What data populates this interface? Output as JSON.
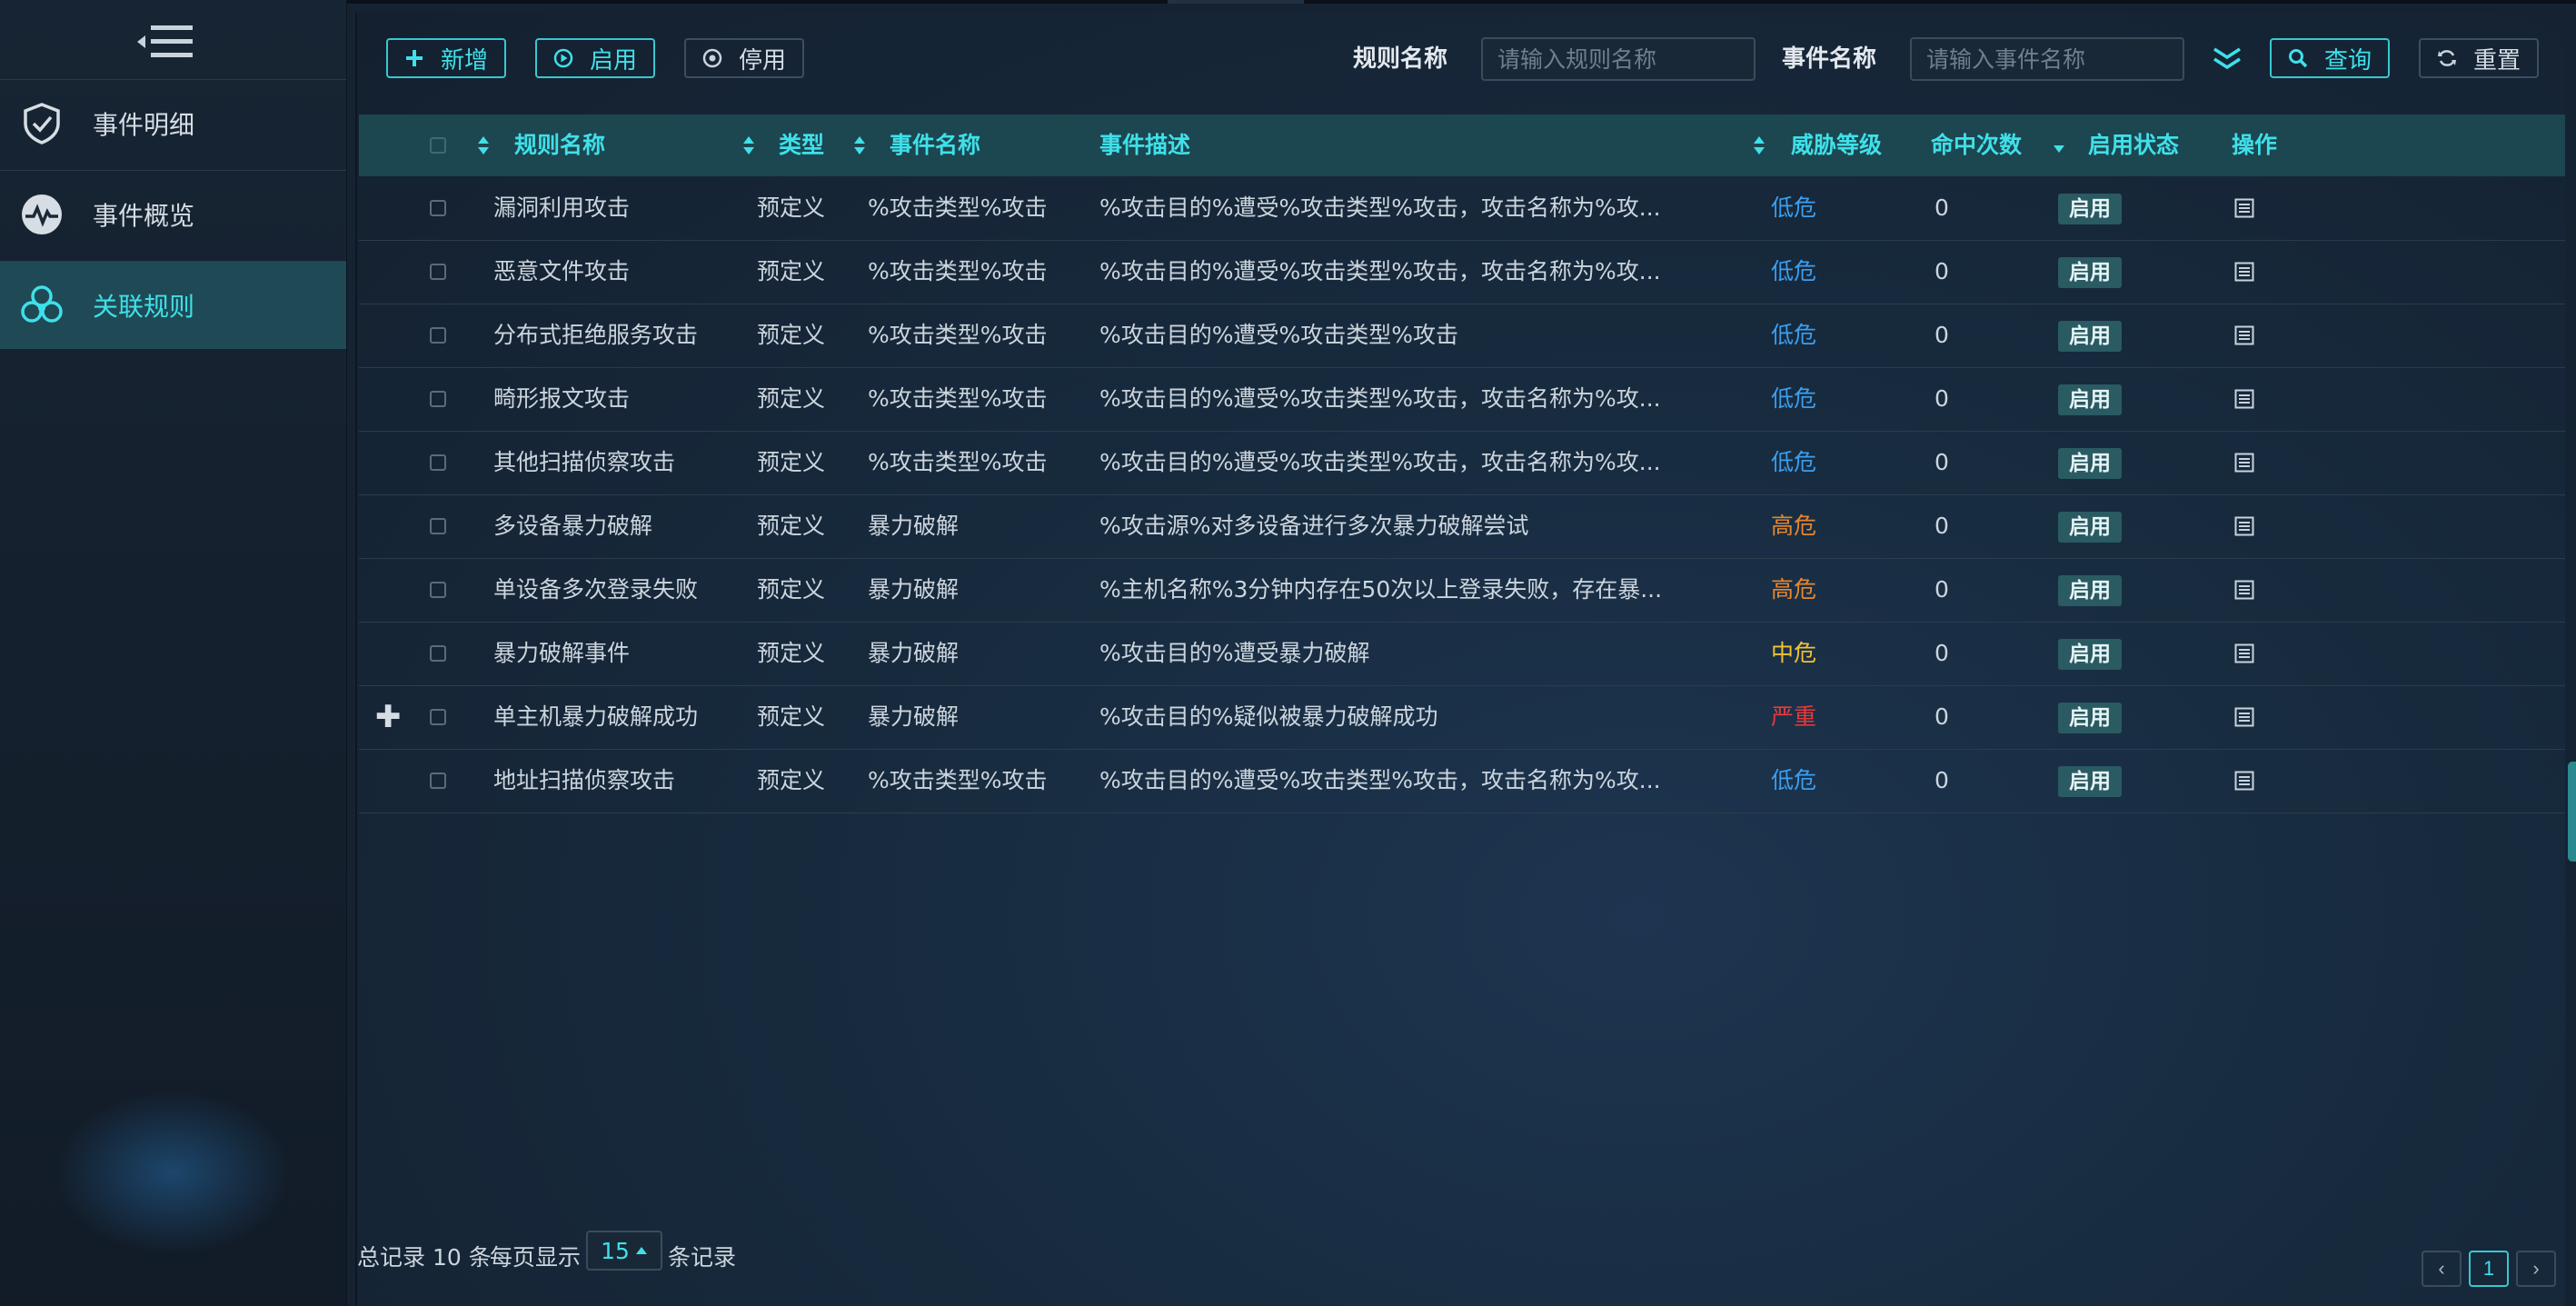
{
  "sidebar": {
    "items": [
      {
        "label": "事件明细",
        "icon": "shield-check-icon",
        "active": false
      },
      {
        "label": "事件概览",
        "icon": "pulse-icon",
        "active": false
      },
      {
        "label": "关联规则",
        "icon": "cloud-link-icon",
        "active": true
      }
    ]
  },
  "toolbar": {
    "add_label": "新增",
    "enable_label": "启用",
    "disable_label": "停用",
    "rule_name_label": "规则名称",
    "rule_name_placeholder": "请输入规则名称",
    "event_name_label": "事件名称",
    "event_name_placeholder": "请输入事件名称",
    "query_label": "查询",
    "reset_label": "重置"
  },
  "table": {
    "headers": {
      "rule_name": "规则名称",
      "type": "类型",
      "event_name": "事件名称",
      "event_desc": "事件描述",
      "threat_level": "威胁等级",
      "hit_count": "命中次数",
      "status": "启用状态",
      "actions": "操作"
    },
    "rows": [
      {
        "rule_name": "漏洞利用攻击",
        "type": "预定义",
        "event_name": "%攻击类型%攻击",
        "event_desc": "%攻击目的%遭受%攻击类型%攻击，攻击名称为%攻...",
        "threat_level": "低危",
        "hit_count": "0",
        "status": "启用"
      },
      {
        "rule_name": "恶意文件攻击",
        "type": "预定义",
        "event_name": "%攻击类型%攻击",
        "event_desc": "%攻击目的%遭受%攻击类型%攻击，攻击名称为%攻...",
        "threat_level": "低危",
        "hit_count": "0",
        "status": "启用"
      },
      {
        "rule_name": "分布式拒绝服务攻击",
        "type": "预定义",
        "event_name": "%攻击类型%攻击",
        "event_desc": "%攻击目的%遭受%攻击类型%攻击",
        "threat_level": "低危",
        "hit_count": "0",
        "status": "启用"
      },
      {
        "rule_name": "畸形报文攻击",
        "type": "预定义",
        "event_name": "%攻击类型%攻击",
        "event_desc": "%攻击目的%遭受%攻击类型%攻击，攻击名称为%攻...",
        "threat_level": "低危",
        "hit_count": "0",
        "status": "启用"
      },
      {
        "rule_name": "其他扫描侦察攻击",
        "type": "预定义",
        "event_name": "%攻击类型%攻击",
        "event_desc": "%攻击目的%遭受%攻击类型%攻击，攻击名称为%攻...",
        "threat_level": "低危",
        "hit_count": "0",
        "status": "启用"
      },
      {
        "rule_name": "多设备暴力破解",
        "type": "预定义",
        "event_name": "暴力破解",
        "event_desc": "%攻击源%对多设备进行多次暴力破解尝试",
        "threat_level": "高危",
        "hit_count": "0",
        "status": "启用"
      },
      {
        "rule_name": "单设备多次登录失败",
        "type": "预定义",
        "event_name": "暴力破解",
        "event_desc": "%主机名称%3分钟内存在50次以上登录失败，存在暴...",
        "threat_level": "高危",
        "hit_count": "0",
        "status": "启用"
      },
      {
        "rule_name": "暴力破解事件",
        "type": "预定义",
        "event_name": "暴力破解",
        "event_desc": "%攻击目的%遭受暴力破解",
        "threat_level": "中危",
        "hit_count": "0",
        "status": "启用"
      },
      {
        "rule_name": "单主机暴力破解成功",
        "type": "预定义",
        "event_name": "暴力破解",
        "event_desc": "%攻击目的%疑似被暴力破解成功",
        "threat_level": "严重",
        "hit_count": "0",
        "status": "启用"
      },
      {
        "rule_name": "地址扫描侦察攻击",
        "type": "预定义",
        "event_name": "%攻击类型%攻击",
        "event_desc": "%攻击目的%遭受%攻击类型%攻击，攻击名称为%攻...",
        "threat_level": "低危",
        "hit_count": "0",
        "status": "启用"
      }
    ],
    "expand_symbol": "✚"
  },
  "threat_colors": {
    "低危": "#3b9ff0",
    "高危": "#e8862e",
    "中危": "#f2c233",
    "严重": "#e83a3a"
  },
  "footer": {
    "total_prefix": "总记录",
    "total_count": "10",
    "total_suffix": "条",
    "per_page_label": "每页显示",
    "page_size": "15",
    "per_page_suffix": "条记录",
    "current_page": "1",
    "prev_symbol": "‹",
    "next_symbol": "›"
  }
}
